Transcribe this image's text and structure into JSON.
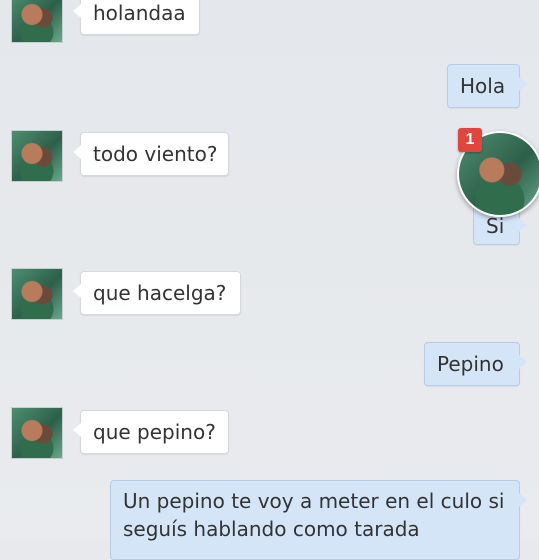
{
  "messages": [
    {
      "direction": "incoming",
      "text": "holandaa"
    },
    {
      "direction": "outgoing",
      "text": "Hola"
    },
    {
      "direction": "incoming",
      "text": "todo viento?"
    },
    {
      "direction": "outgoing",
      "text": "Si"
    },
    {
      "direction": "incoming",
      "text": "que hacelga?"
    },
    {
      "direction": "outgoing",
      "text": "Pepino"
    },
    {
      "direction": "incoming",
      "text": "que pepino?"
    },
    {
      "direction": "outgoing",
      "text": "Un pepino te voy a meter en el culo si seguís hablando como tarada"
    }
  ],
  "chathead": {
    "unread_count": "1",
    "icon": "contact-photo"
  },
  "colors": {
    "background": "#e7e9ec",
    "incoming_bubble": "#ffffff",
    "outgoing_bubble": "#d5e5f8",
    "badge": "#e0463e"
  }
}
